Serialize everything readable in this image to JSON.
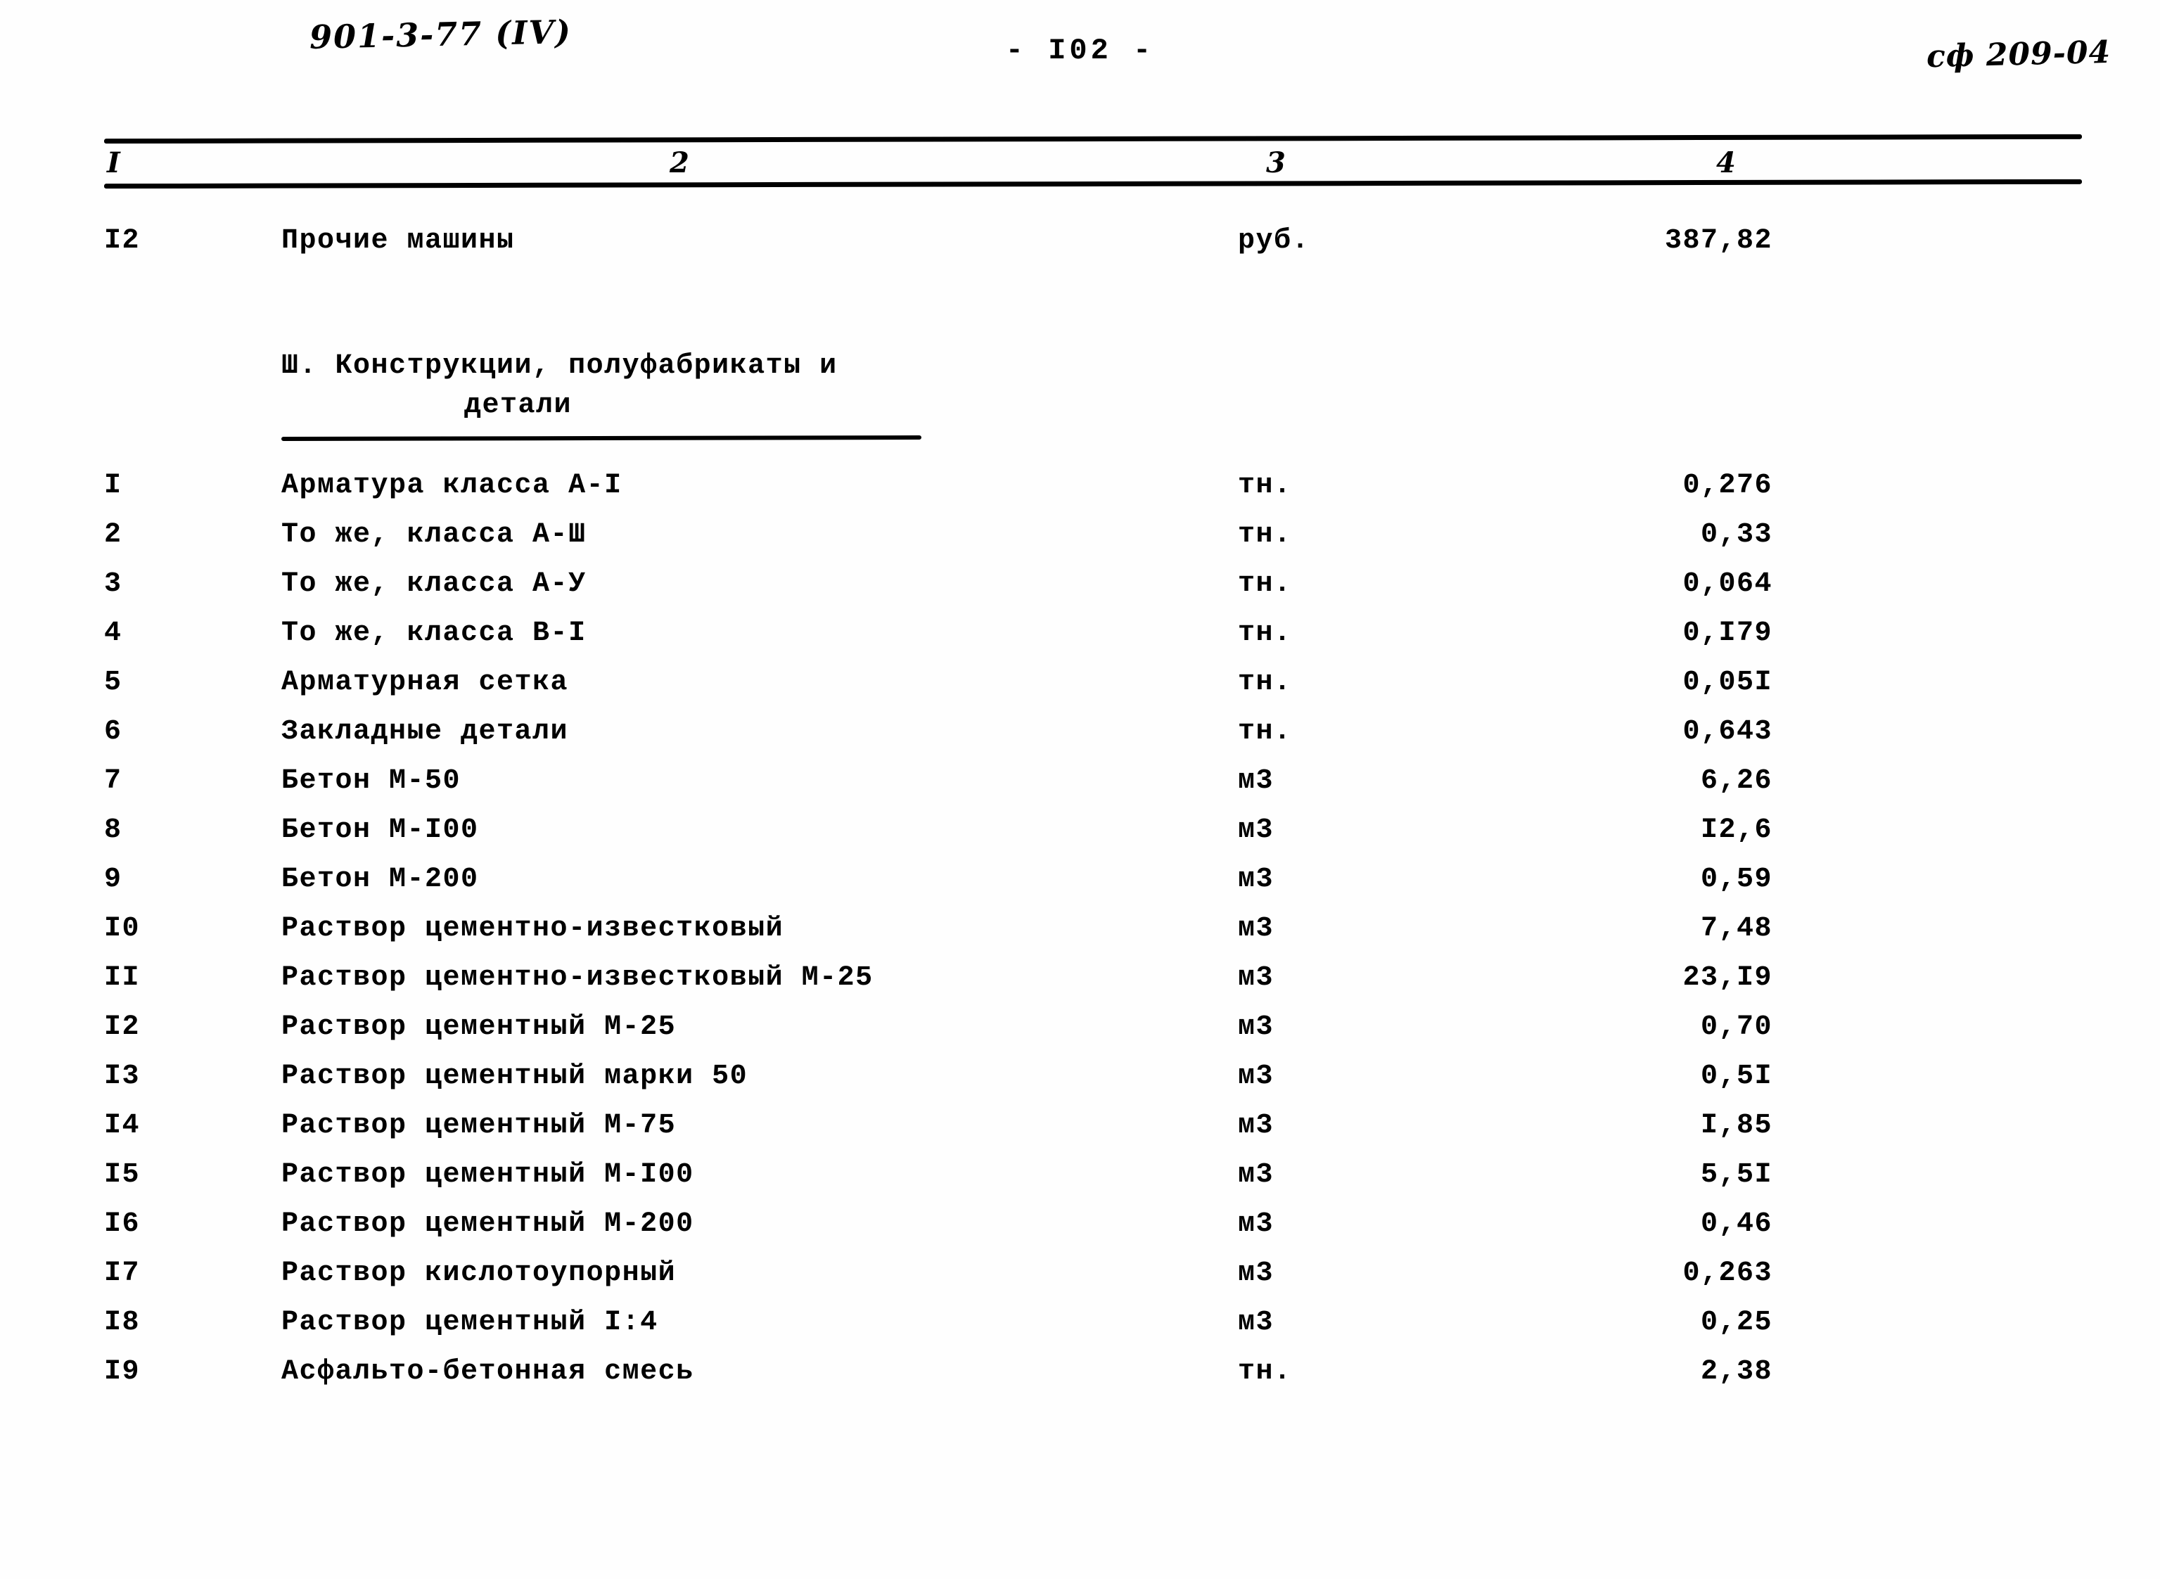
{
  "header": {
    "project_stamp": "901-3-77  (IV)",
    "page_number": "- I02 -",
    "sheet_stamp": "сф 209-04"
  },
  "table": {
    "column_headers": [
      "I",
      "2",
      "3",
      "4"
    ],
    "rows_before_section": [
      {
        "no": "I2",
        "name": "Прочие машины",
        "unit": "руб.",
        "value": "387,82"
      }
    ],
    "section": {
      "line1": "Ш. Конструкции, полуфабрикаты и",
      "line2": "детали"
    },
    "rows": [
      {
        "no": "I",
        "name": "Арматура класса А-I",
        "unit": "тн.",
        "value": "0,276"
      },
      {
        "no": "2",
        "name": "То же, класса А-Ш",
        "unit": "тн.",
        "value": "0,33"
      },
      {
        "no": "3",
        "name": "То же, класса А-У",
        "unit": "тн.",
        "value": "0,064"
      },
      {
        "no": "4",
        "name": "То же, класса В-I",
        "unit": "тн.",
        "value": "0,I79"
      },
      {
        "no": "5",
        "name": "Арматурная сетка",
        "unit": "тн.",
        "value": "0,05I"
      },
      {
        "no": "6",
        "name": "Закладные детали",
        "unit": "тн.",
        "value": "0,643"
      },
      {
        "no": "7",
        "name": "Бетон М-50",
        "unit": "м3",
        "value": "6,26"
      },
      {
        "no": "8",
        "name": "Бетон М-I00",
        "unit": "м3",
        "value": "I2,6"
      },
      {
        "no": "9",
        "name": "Бетон М-200",
        "unit": "м3",
        "value": "0,59"
      },
      {
        "no": "I0",
        "name": "Раствор цементно-известковый",
        "unit": "м3",
        "value": "7,48"
      },
      {
        "no": "II",
        "name": "Раствор цементно-известковый М-25",
        "unit": "м3",
        "value": "23,I9"
      },
      {
        "no": "I2",
        "name": "Раствор цементный М-25",
        "unit": "м3",
        "value": "0,70"
      },
      {
        "no": "I3",
        "name": "Раствор цементный марки 50",
        "unit": "м3",
        "value": "0,5I"
      },
      {
        "no": "I4",
        "name": "Раствор цементный М-75",
        "unit": "м3",
        "value": "I,85"
      },
      {
        "no": "I5",
        "name": "Раствор цементный М-I00",
        "unit": "м3",
        "value": "5,5I"
      },
      {
        "no": "I6",
        "name": "Раствор цементный М-200",
        "unit": "м3",
        "value": "0,46"
      },
      {
        "no": "I7",
        "name": "Раствор кислотоупорный",
        "unit": "м3",
        "value": "0,263"
      },
      {
        "no": "I8",
        "name": "Раствор цементный I:4",
        "unit": "м3",
        "value": "0,25"
      },
      {
        "no": "I9",
        "name": "Асфальто-бетонная смесь",
        "unit": "тн.",
        "value": "2,38"
      }
    ]
  }
}
